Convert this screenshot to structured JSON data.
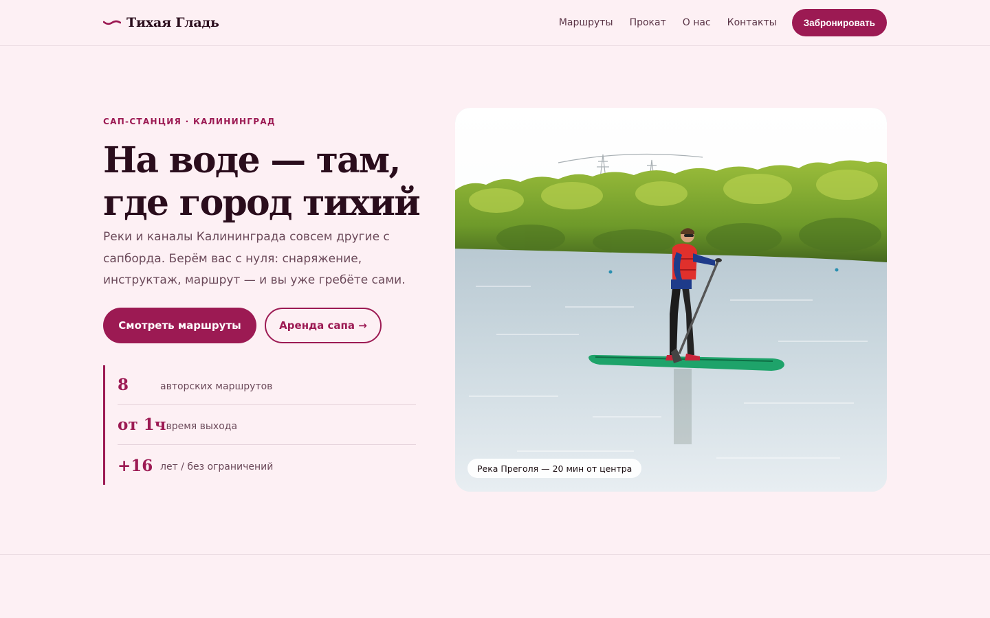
{
  "brand": {
    "name": "Тихая Гладь",
    "accent": "#9c1a53",
    "background": "#fdf0f4"
  },
  "nav": {
    "items": [
      "Маршруты",
      "Прокат",
      "О нас",
      "Контакты"
    ],
    "cta": "Забронировать"
  },
  "hero": {
    "eyebrow": "САП-СТАНЦИЯ · КАЛИНИНГРАД",
    "headline_line1": "На воде — там,",
    "headline_line2": "где город тихий",
    "lead": "Реки и каналы Калининграда совсем другие с сапборда. Берём вас с нуля: снаряжение, инструктаж, маршрут — и вы уже гребёте сами.",
    "primary_button": "Смотреть маршруты",
    "secondary_button": "Аренда сапа →",
    "stats": [
      {
        "value": "8",
        "label": "авторских маршрутов"
      },
      {
        "value": "от 1ч",
        "label": "время выхода"
      },
      {
        "value": "+16",
        "label": "лет / без ограничений"
      }
    ],
    "photo_caption": "Река Преголя — 20 мин от центра"
  },
  "icons": {
    "logo": "wave-icon",
    "photo": "paddleboarder-photo"
  }
}
